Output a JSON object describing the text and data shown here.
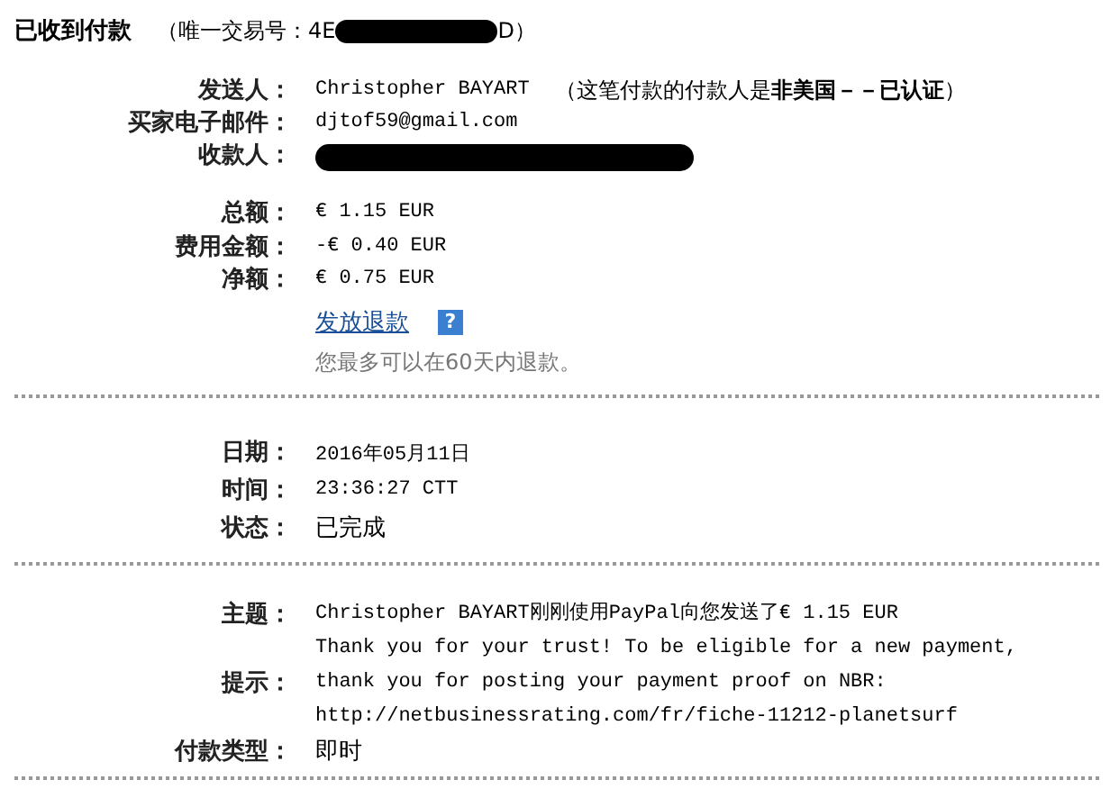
{
  "header": {
    "title": "已收到付款",
    "transaction_prefix": "（唯一交易号：4E",
    "transaction_suffix": "D）",
    "redacted": true
  },
  "parties": [
    {
      "label": "发送人：",
      "value": "Christopher BAYART",
      "note": "（这笔付款的付款人是**非美国－－已认证**）"
    },
    {
      "label": "买家电子邮件：",
      "value": "djtof59@gmail.com"
    },
    {
      "label": "收款人：",
      "redacted": true
    }
  ],
  "amounts": [
    {
      "label": "总额：",
      "value": "€ 1.15 EUR"
    },
    {
      "label": "费用金额：",
      "value": "-€ 0.40 EUR"
    },
    {
      "label": "净额：",
      "value": "€ 0.75 EUR"
    }
  ],
  "refund": {
    "link": "发放退款",
    "help": "?",
    "note": "您最多可以在60天内退款。"
  },
  "details": [
    {
      "label": "日期：",
      "value": "2016年05月11日"
    },
    {
      "label": "时间：",
      "value": "23:36:27 CTT"
    },
    {
      "label": "状态：",
      "value": "已完成"
    }
  ],
  "message": [
    {
      "label": "主题：",
      "value": "Christopher BAYART刚刚使用PayPal向您发送了€ 1.15 EUR"
    },
    {
      "label": "提示：",
      "value": "Thank you for your trust! To be eligible for a new payment, thank you for posting your payment proof on NBR: http://netbusinessrating.com/fr/fiche-11212-planetsurf"
    },
    {
      "label": "付款类型：",
      "value": "即时"
    }
  ]
}
